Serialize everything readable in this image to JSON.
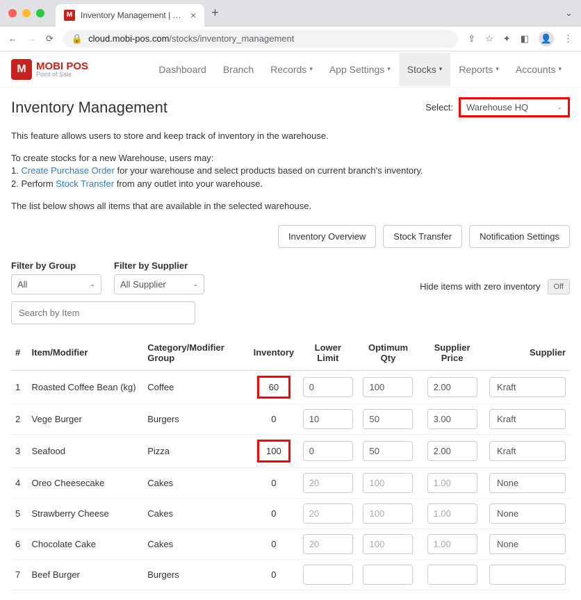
{
  "browser": {
    "tab_title": "Inventory Management | MobiP",
    "url_domain": "cloud.mobi-pos.com",
    "url_path": "/stocks/inventory_management"
  },
  "logo": {
    "badge": "M",
    "brand": "MOBI POS",
    "sub": "Point of Sale"
  },
  "nav": {
    "items": [
      {
        "label": "Dashboard",
        "dropdown": false
      },
      {
        "label": "Branch",
        "dropdown": false
      },
      {
        "label": "Records",
        "dropdown": true
      },
      {
        "label": "App Settings",
        "dropdown": true
      },
      {
        "label": "Stocks",
        "dropdown": true,
        "active": true
      },
      {
        "label": "Reports",
        "dropdown": true
      },
      {
        "label": "Accounts",
        "dropdown": true
      }
    ]
  },
  "page": {
    "title": "Inventory Management",
    "select_label": "Select:",
    "select_value": "Warehouse HQ",
    "intro1": "This feature allows users to store and keep track of inventory in the warehouse.",
    "intro2_lead": "To create stocks for a new Warehouse, users may:",
    "intro2_line1_prefix": "1. ",
    "intro2_link1": "Create Purchase Order",
    "intro2_line1_suffix": " for your warehouse and select products based on current branch's inventory.",
    "intro2_line2_prefix": "2. Perform ",
    "intro2_link2": "Stock Transfer",
    "intro2_line2_suffix": " from any outlet into your warehouse.",
    "intro3": "The list below shows all items that are available in the selected warehouse."
  },
  "actions": {
    "overview": "Inventory Overview",
    "transfer": "Stock Transfer",
    "notify": "Notification Settings"
  },
  "filters": {
    "group_label": "Filter by Group",
    "group_value": "All",
    "supplier_label": "Filter by Supplier",
    "supplier_value": "All Supplier",
    "hide_zero_label": "Hide items with zero inventory",
    "toggle_text": "Off",
    "search_placeholder": "Search by Item"
  },
  "table": {
    "headers": {
      "num": "#",
      "item": "Item/Modifier",
      "cat": "Category/Modifier Group",
      "inv": "Inventory",
      "ll": "Lower Limit",
      "oq": "Optimum Qty",
      "sp": "Supplier Price",
      "sup": "Supplier"
    },
    "rows": [
      {
        "n": "1",
        "item": "Roasted Coffee Bean (kg)",
        "cat": "Coffee",
        "inv": "60",
        "hl": true,
        "ll": "0",
        "oq": "100",
        "sp": "2.00",
        "sup": "Kraft",
        "disabled": false
      },
      {
        "n": "2",
        "item": "Vege Burger",
        "cat": "Burgers",
        "inv": "0",
        "hl": false,
        "ll": "10",
        "oq": "50",
        "sp": "3.00",
        "sup": "Kraft",
        "disabled": false
      },
      {
        "n": "3",
        "item": "Seafood",
        "cat": "Pizza",
        "inv": "100",
        "hl": true,
        "ll": "0",
        "oq": "50",
        "sp": "2.00",
        "sup": "Kraft",
        "disabled": false
      },
      {
        "n": "4",
        "item": "Oreo Cheesecake",
        "cat": "Cakes",
        "inv": "0",
        "hl": false,
        "ll": "20",
        "oq": "100",
        "sp": "1.00",
        "sup": "None",
        "disabled": true
      },
      {
        "n": "5",
        "item": "Strawberry Cheese",
        "cat": "Cakes",
        "inv": "0",
        "hl": false,
        "ll": "20",
        "oq": "100",
        "sp": "1.00",
        "sup": "None",
        "disabled": true
      },
      {
        "n": "6",
        "item": "Chocolate Cake",
        "cat": "Cakes",
        "inv": "0",
        "hl": false,
        "ll": "20",
        "oq": "100",
        "sp": "1.00",
        "sup": "None",
        "disabled": true
      },
      {
        "n": "7",
        "item": "Beef Burger",
        "cat": "Burgers",
        "inv": "0",
        "hl": false,
        "ll": "",
        "oq": "",
        "sp": "",
        "sup": "",
        "disabled": true
      }
    ]
  }
}
